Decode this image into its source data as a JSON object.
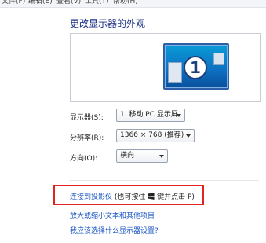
{
  "menubar": {
    "items": [
      "文件(F)",
      "编辑(E)",
      "查看(V)",
      "工具(T)",
      "帮助(H)"
    ]
  },
  "page_title": "更改显示器的外观",
  "monitor": {
    "badge_number": "1"
  },
  "fields": {
    "display": {
      "label": "显示器(S):",
      "value": "1. 移动 PC 显示屏"
    },
    "resolution": {
      "label": "分辨率(R):",
      "value": "1366 × 768 (推荐)"
    },
    "orientation": {
      "label": "方向(O):",
      "value": "横向"
    }
  },
  "links": {
    "projector": {
      "link_text": "连接到投影仪",
      "hint_prefix": " (也可按住 ",
      "hint_suffix": " 键并点击 P)"
    },
    "text_size": "放大或缩小文本和其他项目",
    "which_settings": "我应该选择什么显示器设置?"
  },
  "colors": {
    "link": "#1b57c4",
    "title": "#1e3287",
    "highlight": "#e02424"
  },
  "icons": {
    "windows_key": "windows-logo-icon",
    "combo_arrow": "chevron-down-icon"
  }
}
